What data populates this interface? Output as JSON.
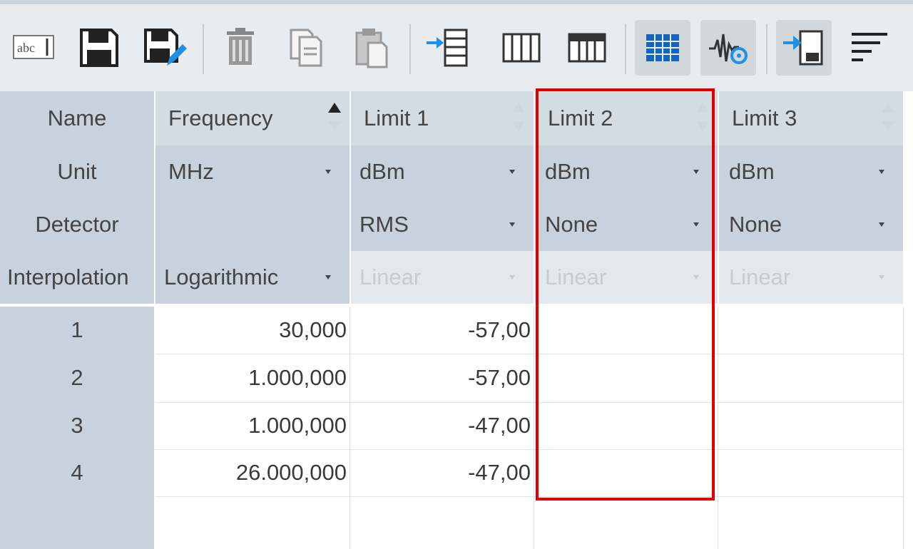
{
  "toolbar": {
    "buttons": [
      {
        "id": "rename",
        "icon": "abc-text-icon",
        "text": "abc"
      },
      {
        "id": "save",
        "icon": "floppy-disk-icon"
      },
      {
        "id": "save-as",
        "icon": "floppy-disk-edit-icon"
      },
      {
        "id": "delete",
        "icon": "trash-icon"
      },
      {
        "id": "copy",
        "icon": "copy-icon"
      },
      {
        "id": "paste",
        "icon": "paste-icon"
      },
      {
        "id": "insert-row",
        "icon": "insert-row-icon"
      },
      {
        "id": "columns",
        "icon": "columns-icon"
      },
      {
        "id": "table-header",
        "icon": "table-header-icon"
      },
      {
        "id": "grid-view",
        "icon": "grid-table-icon",
        "pressed": true
      },
      {
        "id": "signal-view",
        "icon": "waveform-icon",
        "pressed": true
      },
      {
        "id": "import",
        "icon": "import-arrow-icon",
        "pressed": true
      },
      {
        "id": "sort",
        "icon": "sort-lines-icon"
      }
    ]
  },
  "table": {
    "row_labels": {
      "name": "Name",
      "unit": "Unit",
      "detector": "Detector",
      "interpolation": "Interpolation"
    },
    "columns": [
      {
        "name": "Frequency",
        "unit": "MHz",
        "detector": "",
        "interpolation": "Logarithmic",
        "interpolation_enabled": true,
        "sort": "ascending",
        "values": [
          "30,000",
          "1.000,000",
          "1.000,000",
          "26.000,000"
        ]
      },
      {
        "name": "Limit 1",
        "unit": "dBm",
        "detector": "RMS",
        "interpolation": "Linear",
        "interpolation_enabled": false,
        "sort": "none",
        "values": [
          "-57,00",
          "-57,00",
          "-47,00",
          "-47,00"
        ]
      },
      {
        "name": "Limit 2",
        "unit": "dBm",
        "detector": "None",
        "interpolation": "Linear",
        "interpolation_enabled": false,
        "sort": "none",
        "values": [
          "",
          "",
          "",
          ""
        ]
      },
      {
        "name": "Limit 3",
        "unit": "dBm",
        "detector": "None",
        "interpolation": "Linear",
        "interpolation_enabled": false,
        "sort": "none",
        "values": [
          "",
          "",
          "",
          ""
        ]
      }
    ],
    "rows": [
      "1",
      "2",
      "3",
      "4"
    ]
  },
  "colors": {
    "header_bg": "#c8d2dc",
    "highlight": "#e00000",
    "icon_blue": "#1e90e6",
    "icon_dark": "#333333"
  }
}
